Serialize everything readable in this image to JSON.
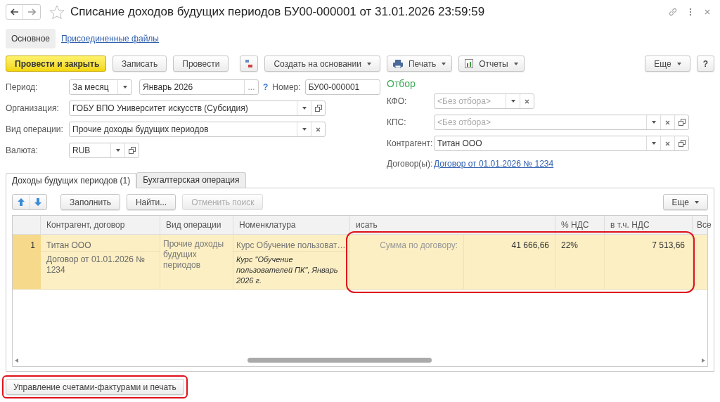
{
  "window": {
    "title": "Списание доходов будущих периодов БУ00-000001 от 31.01.2026 23:59:59"
  },
  "form_tabs": [
    {
      "label": "Основное",
      "selected": true
    },
    {
      "label": "Присоединенные файлы",
      "selected": false
    }
  ],
  "toolbar": [
    {
      "kind": "primary",
      "label": "Провести и закрыть"
    },
    {
      "kind": "button",
      "label": "Записать"
    },
    {
      "kind": "button",
      "label": "Провести"
    },
    {
      "kind": "dtkt"
    },
    {
      "kind": "menu",
      "label": "Создать на основании"
    },
    {
      "kind": "print",
      "label": "Печать"
    },
    {
      "kind": "reports",
      "label": "Отчеты"
    },
    {
      "kind": "more",
      "label": "Еще"
    },
    {
      "kind": "help",
      "label": "?"
    }
  ],
  "period": {
    "label": "Период:",
    "type": {
      "value": "За месяц",
      "buttons": [
        {
          "kind": "dropdown"
        }
      ]
    },
    "month": {
      "value": "Январь 2026",
      "buttons": [
        {
          "kind": "choose",
          "text": "..."
        }
      ]
    },
    "help": "?",
    "number_label": "Номер:",
    "number": {
      "value": "БУ00-000001"
    }
  },
  "organization": {
    "label": "Организация:",
    "value": "ГОБУ ВПО Университет искусств (Субсидия)",
    "buttons": [
      {
        "kind": "dropdown"
      },
      {
        "kind": "open"
      }
    ]
  },
  "operation": {
    "label": "Вид операции:",
    "value": "Прочие доходы будущих периодов",
    "buttons": [
      {
        "kind": "dropdown"
      },
      {
        "kind": "clear"
      }
    ]
  },
  "currency": {
    "label": "Валюта:",
    "value": "RUB",
    "buttons": [
      {
        "kind": "dropdown"
      },
      {
        "kind": "open"
      }
    ]
  },
  "filter": {
    "title": "Отбор",
    "kfo": {
      "label": "КФО:",
      "placeholder": "<Без отбора>",
      "buttons": [
        {
          "kind": "dropdown"
        },
        {
          "kind": "clear"
        }
      ]
    },
    "kps": {
      "label": "КПС:",
      "placeholder": "<Без отбора>",
      "buttons": [
        {
          "kind": "dropdown"
        },
        {
          "kind": "clear"
        },
        {
          "kind": "open"
        }
      ]
    },
    "counterparty": {
      "label": "Контрагент:",
      "value": "Титан ООО",
      "buttons": [
        {
          "kind": "dropdown"
        },
        {
          "kind": "clear"
        },
        {
          "kind": "open"
        }
      ]
    },
    "contracts": {
      "label": "Договор(ы):",
      "link": "Договор от 01.01.2026 № 1234"
    }
  },
  "tabs": [
    {
      "label": "Доходы будущих периодов (1)",
      "selected": true
    },
    {
      "label": "Бухгалтерская операция",
      "selected": false
    }
  ],
  "table_toolbar": [
    {
      "kind": "up",
      "disabled": false
    },
    {
      "kind": "down",
      "disabled": false
    },
    {
      "kind": "button",
      "label": "Заполнить",
      "disabled": false
    },
    {
      "kind": "button",
      "label": "Найти...",
      "disabled": false
    },
    {
      "kind": "button",
      "label": "Отменить поиск",
      "disabled": true
    },
    {
      "kind": "more",
      "label": "Еще",
      "disabled": false
    }
  ],
  "table": {
    "columns": [
      {
        "label": "Контрагент, договор"
      },
      {
        "label": "Вид операции"
      },
      {
        "label": "Номенклатура"
      },
      {
        "label": "исать"
      },
      {
        "label": "% НДС"
      },
      {
        "label": "в т.ч. НДС"
      },
      {
        "label": "Все"
      }
    ],
    "rows": [
      {
        "number": "1",
        "selected": true,
        "highlighted": true,
        "counterparty": "Титан ООО",
        "contract": "Договор от 01.01.2026 № 1234",
        "operation": "Прочие доходы будущих периодов",
        "item": "Курс Обучение пользоват…",
        "item_description": "Курс \"Обучение пользователей ПК\", Январь 2026 г.",
        "sum_label": "Сумма по договору:",
        "sum": "41 666,66",
        "vat_rate": "22%",
        "vat": "7 513,66"
      }
    ]
  },
  "bottom_button": {
    "label": "Управление счетами-фактурами и печать",
    "highlighted": true
  }
}
